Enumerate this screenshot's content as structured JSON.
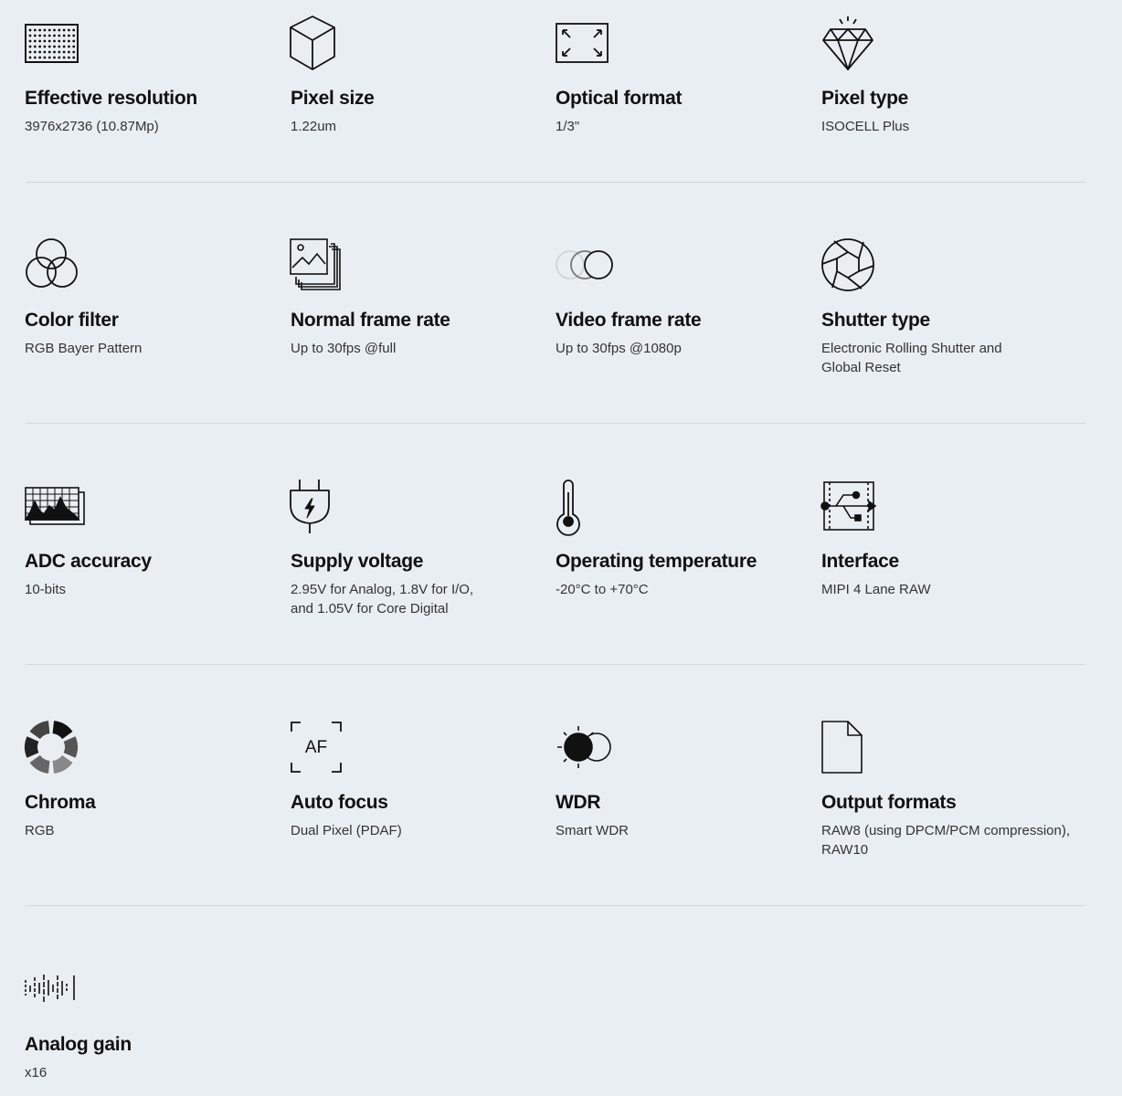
{
  "specs": [
    {
      "title": "Effective resolution",
      "value": "3976x2736 (10.87Mp)",
      "icon": "dot-grid-icon"
    },
    {
      "title": "Pixel size",
      "value": "1.22um",
      "icon": "cube-icon"
    },
    {
      "title": "Optical format",
      "value": "1/3\"",
      "icon": "expand-frame-icon"
    },
    {
      "title": "Pixel type",
      "value": "ISOCELL Plus",
      "icon": "diamond-icon"
    },
    {
      "title": "Color filter",
      "value": "RGB Bayer Pattern",
      "icon": "three-circles-icon"
    },
    {
      "title": "Normal frame rate",
      "value": "Up to 30fps @full",
      "icon": "stacked-photos-icon"
    },
    {
      "title": "Video frame rate",
      "value": "Up to 30fps @1080p",
      "icon": "overlapping-circles-icon"
    },
    {
      "title": "Shutter type",
      "value": "Electronic Rolling Shutter and Global Reset",
      "icon": "aperture-icon"
    },
    {
      "title": "ADC accuracy",
      "value": "10-bits",
      "icon": "histogram-icon"
    },
    {
      "title": "Supply voltage",
      "value": "2.95V for Analog, 1.8V for I/O, and 1.05V for Core Digital",
      "icon": "plug-icon"
    },
    {
      "title": "Operating temperature",
      "value": "-20°C to +70°C",
      "icon": "thermometer-icon"
    },
    {
      "title": "Interface",
      "value": "MIPI 4 Lane RAW",
      "icon": "circuit-icon"
    },
    {
      "title": "Chroma",
      "value": "RGB",
      "icon": "chroma-ring-icon"
    },
    {
      "title": "Auto focus",
      "value": "Dual Pixel (PDAF)",
      "icon": "autofocus-icon"
    },
    {
      "title": "WDR",
      "value": "Smart WDR",
      "icon": "sun-circle-icon"
    },
    {
      "title": "Output formats",
      "value": "RAW8 (using DPCM/PCM compression), RAW10",
      "icon": "document-icon"
    },
    {
      "title": "Analog gain",
      "value": "x16",
      "icon": "waveform-icon"
    }
  ],
  "icon_labels": {
    "autofocus": "AF"
  },
  "colors": {
    "background": "#e9eef3",
    "divider": "#d2d8de",
    "text": "#111111",
    "subtext": "#333333"
  }
}
